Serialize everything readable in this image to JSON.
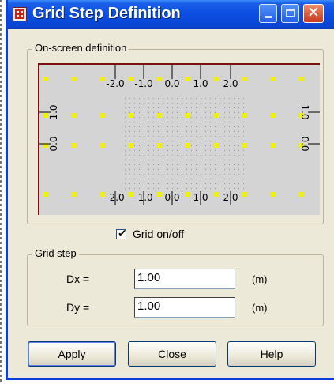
{
  "window": {
    "title": "Grid Step Definition",
    "controls": {
      "minimize": "minimize",
      "maximize": "maximize",
      "close": "✕"
    }
  },
  "onscreen": {
    "legend": "On-screen definition",
    "top_labels": [
      "-2.0",
      "-1.0",
      "0.0",
      "1.0",
      "2.0"
    ],
    "bottom_labels": [
      "-2.0",
      "-1.0",
      "0.0",
      "1.0",
      "2.0"
    ],
    "left_labels": [
      "1.0",
      "0.0"
    ],
    "right_labels": [
      "1.0",
      "0.0"
    ],
    "colors": {
      "background": "#d4d4d4",
      "grid_points": "#f2f200",
      "fine_grid": "#9a9a9a",
      "border": "#7a1010"
    }
  },
  "grid_toggle": {
    "label": "Grid on/off",
    "checked": true,
    "check_glyph": "✔"
  },
  "grid_step": {
    "legend": "Grid step",
    "dx": {
      "label": "Dx =",
      "value": "1.00",
      "unit": "(m)"
    },
    "dy": {
      "label": "Dy =",
      "value": "1.00",
      "unit": "(m)"
    }
  },
  "buttons": {
    "apply": "Apply",
    "close": "Close",
    "help": "Help"
  }
}
